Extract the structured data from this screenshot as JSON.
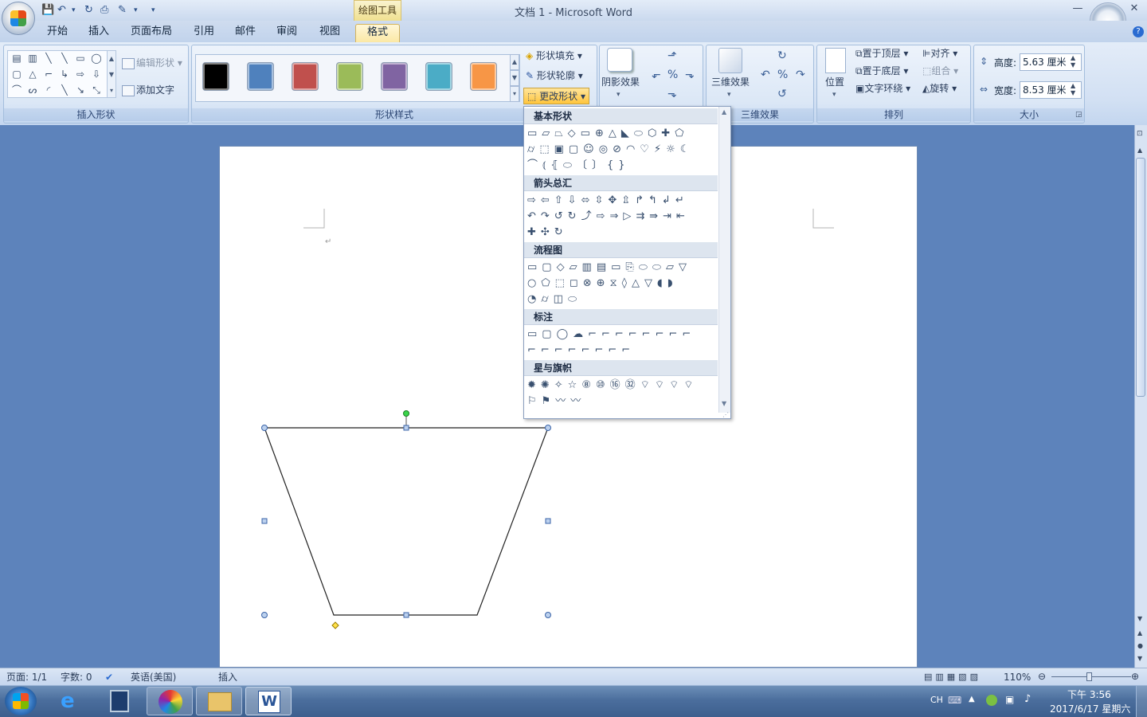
{
  "app": {
    "title": "文档 1 - Microsoft Word",
    "context_tab": "绘图工具"
  },
  "tabs": [
    {
      "label": "开始"
    },
    {
      "label": "插入"
    },
    {
      "label": "页面布局"
    },
    {
      "label": "引用"
    },
    {
      "label": "邮件"
    },
    {
      "label": "审阅"
    },
    {
      "label": "视图"
    },
    {
      "label": "格式",
      "active": true
    }
  ],
  "ribbon": {
    "insert_shapes": {
      "label": "插入形状",
      "edit_shape": "编辑形状",
      "add_text": "添加文字"
    },
    "shape_styles": {
      "label": "形状样式",
      "swatches": [
        "#000000",
        "#4f81bd",
        "#c0504d",
        "#9bbb59",
        "#8064a2",
        "#4bacc6",
        "#f79646"
      ],
      "fill": "形状填充",
      "outline": "形状轮廓",
      "change_shape": "更改形状"
    },
    "shadow": {
      "label": "阴影效果"
    },
    "three_d": {
      "label": "三维效果",
      "group_label": "三维效果"
    },
    "arrange": {
      "label": "排列",
      "position": "位置",
      "bring_front": "置于顶层",
      "send_back": "置于底层",
      "text_wrap": "文字环绕",
      "align": "对齐",
      "group": "组合",
      "rotate": "旋转"
    },
    "size": {
      "label": "大小",
      "height_label": "高度:",
      "height_value": "5.63 厘米",
      "width_label": "宽度:",
      "width_value": "8.53 厘米"
    }
  },
  "dropdown": {
    "sections": [
      {
        "title": "基本形状",
        "rows": [
          "▭▱⏢◇▭⊕△◣⬭⬡✚⬠",
          "⌭⬚▣▢☺◎⊘◠♡⚡☼☾",
          "⌒⦅⦃⬭〔〕{}"
        ]
      },
      {
        "title": "箭头总汇",
        "rows": [
          "⇨⇦⇧⇩⬄⇳✥⇫↱↰↲↵",
          "↶↷↺↻⤴⇨⇒▷⇉⇛⇥⇤",
          "✚✣↻"
        ]
      },
      {
        "title": "流程图",
        "rows": [
          "▭▢◇▱▥▤▭⎘⬭⬭⏥▽",
          "○⬠⬚◻⊗⊕⧖◊△▽◖◗",
          "◔⌭◫⬭"
        ]
      },
      {
        "title": "标注",
        "rows": [
          "▭▢◯☁⌐⌐⌐⌐⌐⌐⌐⌐",
          "⌐⌐⌐⌐⌐⌐⌐⌐"
        ]
      },
      {
        "title": "星与旗帜",
        "rows": [
          "✹✺✧☆⑧⑩⑯㉜⌔⌔⌔⌔",
          "⚐⚑〰〰"
        ]
      }
    ]
  },
  "status": {
    "page": "页面: 1/1",
    "words": "字数: 0",
    "language": "英语(美国)",
    "mode": "插入",
    "zoom": "110%"
  },
  "tray": {
    "lang": "CH",
    "time": "下午 3:56",
    "date": "2017/6/17 星期六"
  }
}
